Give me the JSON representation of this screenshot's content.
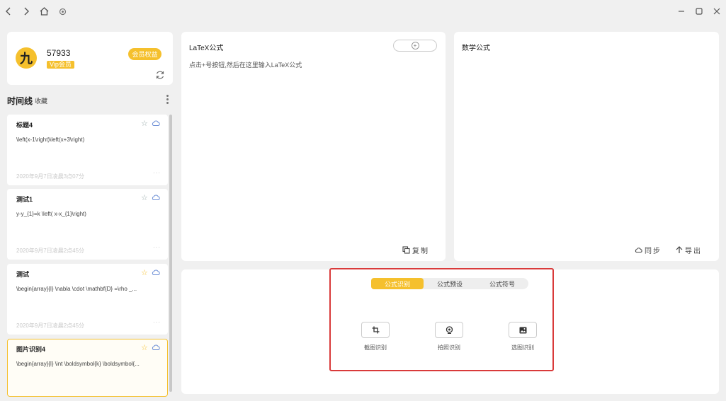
{
  "titlebar": {
    "back_icon": "chevron-left-icon",
    "forward_icon": "chevron-right-icon",
    "home_icon": "home-icon",
    "settings_icon": "gear-icon",
    "minimize_icon": "minimize-icon",
    "maximize_icon": "maximize-icon",
    "close_icon": "close-icon"
  },
  "user": {
    "avatar_char": "九",
    "name": "57933",
    "vip_label": "Vip会员",
    "member_button": "会员权益"
  },
  "timeline": {
    "title": "时间线",
    "favorites_tab": "收藏",
    "items": [
      {
        "title": "标题4",
        "latex": "\\left(x-1\\right)\\left(x+3\\right)",
        "date": "2020年9月7日凌晨3点07分",
        "starred": false
      },
      {
        "title": "测试1",
        "latex": "y-y_{1}=k \\left( x-x_{1}\\right)",
        "date": "2020年9月7日凌晨2点45分",
        "starred": false
      },
      {
        "title": "测试",
        "latex": "\\begin{array}{l} \\nabla \\cdot \\mathbf{D} =\\rho _...",
        "date": "2020年9月7日凌晨2点45分",
        "starred": true
      },
      {
        "title": "图片识别4",
        "latex": "\\begin{array}{l} \\int \\boldsymbol{k} \\boldsymbol{...",
        "date": "",
        "starred": true
      }
    ],
    "more_dots": "···"
  },
  "latex_panel": {
    "title": "LaTeX公式",
    "hint": "点击+号按钮,然后在这里输入LaTeX公式",
    "copy_label": "复制"
  },
  "math_panel": {
    "title": "数学公式",
    "sync_label": "同步",
    "export_label": "导出"
  },
  "recognition": {
    "tabs": [
      "公式识别",
      "公式预设",
      "公式符号"
    ],
    "active_tab": "公式识别",
    "buttons": [
      {
        "label": "截图识别",
        "icon": "crop-icon"
      },
      {
        "label": "拍照识别",
        "icon": "camera-icon"
      },
      {
        "label": "选图识别",
        "icon": "image-icon"
      }
    ]
  },
  "colors": {
    "accent": "#f5c02d",
    "highlight_border": "#d93a3a",
    "cloud": "#6d8fd6"
  }
}
